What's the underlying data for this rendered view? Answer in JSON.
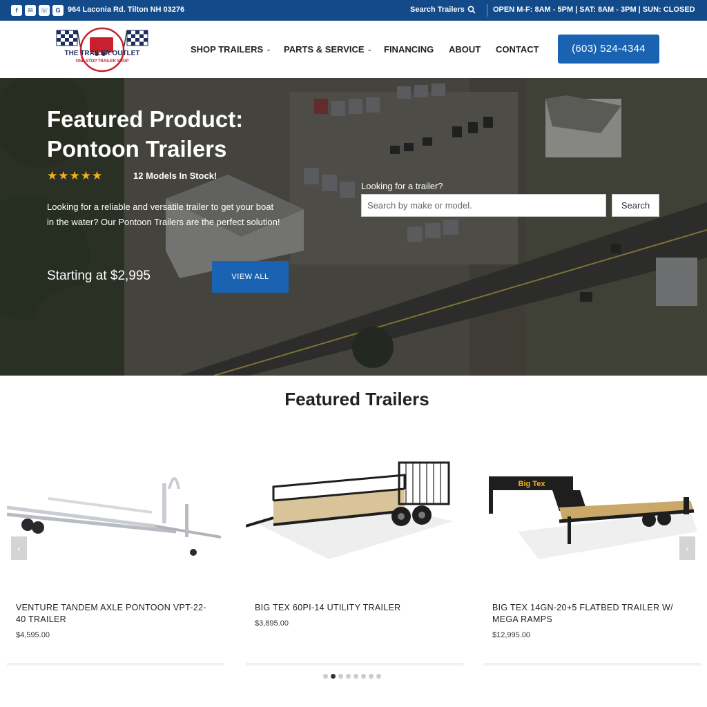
{
  "topbar": {
    "social_icons": [
      {
        "name": "facebook-icon",
        "glyph": "f"
      },
      {
        "name": "email-icon",
        "glyph": "✉"
      },
      {
        "name": "phone-icon",
        "glyph": "☏"
      },
      {
        "name": "google-icon",
        "glyph": "G"
      }
    ],
    "address": "964 Laconia Rd. Tilton NH 03276",
    "search_label": "Search Trailers",
    "hours": "OPEN M-F: 8AM - 5PM | SAT: 8AM - 3PM | SUN: CLOSED",
    "bg_color": "#124a8a"
  },
  "logo": {
    "line1": "THE TRAILER OUTLET",
    "line2": "ONE STOP TRAILER SHOP"
  },
  "nav": {
    "items": [
      {
        "label": "SHOP TRAILERS",
        "dropdown": true
      },
      {
        "label": "PARTS & SERVICE",
        "dropdown": true
      },
      {
        "label": "FINANCING",
        "dropdown": false
      },
      {
        "label": "ABOUT",
        "dropdown": false
      },
      {
        "label": "CONTACT",
        "dropdown": false
      }
    ],
    "phone": "(603) 524-4344"
  },
  "hero": {
    "title": "Featured Product: Pontoon Trailers",
    "rating_stars": "★★★★★",
    "stock": "12 Models In Stock!",
    "description": "Looking for a reliable and versatile trailer to get your boat in the water? Our Pontoon Trailers are the perfect solution!",
    "price": "Starting at $2,995",
    "cta": "VIEW ALL",
    "search_label": "Looking for a trailer?",
    "search_placeholder": "Search by make or model.",
    "search_button": "Search"
  },
  "featured": {
    "title": "Featured Trailers",
    "products": [
      {
        "name": "VENTURE TANDEM AXLE PONTOON VPT-22-40 TRAILER",
        "price": "$4,595.00"
      },
      {
        "name": "BIG TEX 60PI-14 UTILITY TRAILER",
        "price": "$3,895.00"
      },
      {
        "name": "BIG TEX 14GN-20+5 FLATBED TRAILER W/ MEGA RAMPS",
        "price": "$12,995.00"
      }
    ],
    "dots_total": 8,
    "active_dot": 1
  },
  "colors": {
    "accent": "#1a63b3",
    "star": "#f2b01e"
  }
}
